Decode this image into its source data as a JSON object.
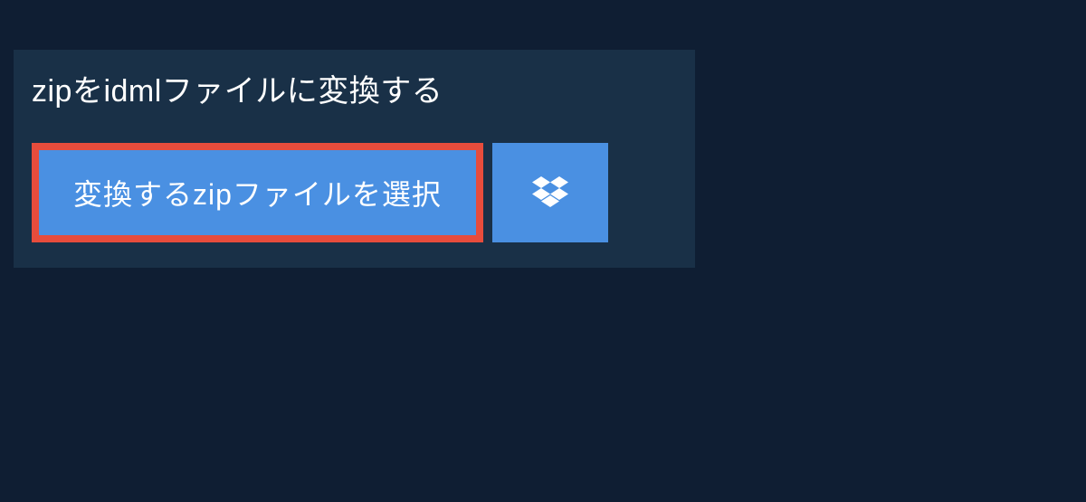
{
  "heading": {
    "text": "zipをidmlファイルに変換する"
  },
  "buttons": {
    "select_file_label": "変換するzipファイルを選択"
  }
}
